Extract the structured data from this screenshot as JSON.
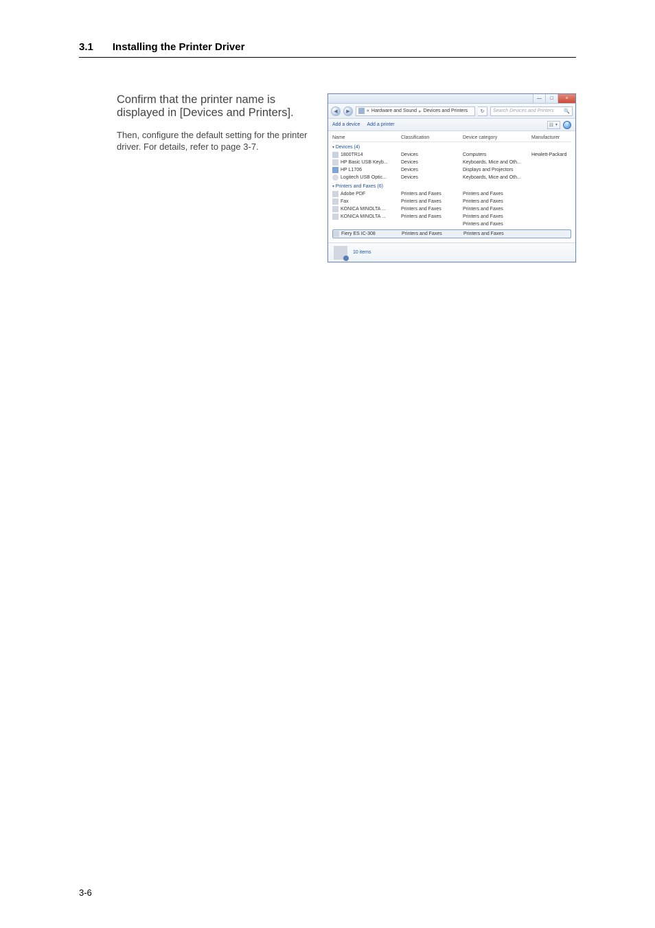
{
  "header": {
    "section_number": "3.1",
    "section_title": "Installing the Printer Driver"
  },
  "body": {
    "para1": "Confirm that the printer name is displayed in [Devices and Printers].",
    "para2": "Then, configure the default setting for the printer driver. For details, refer to page 3-7."
  },
  "win": {
    "breadcrumb": {
      "root_icon": "control-panel-icon",
      "seg1": "«",
      "seg2": "Hardware and Sound",
      "seg3": "Devices and Printers"
    },
    "refresh_tip": "Refresh",
    "search_placeholder": "Search Devices and Printers",
    "cmd": {
      "add_device": "Add a device",
      "add_printer": "Add a printer"
    },
    "columns": {
      "name": "Name",
      "classification": "Classification",
      "category": "Device category",
      "manufacturer": "Manufacturer"
    },
    "groups": {
      "devices": "Devices (4)",
      "printers": "Printers and Faxes (6)"
    },
    "devices": [
      {
        "name": "1800TR14",
        "classification": "Devices",
        "category": "Computers",
        "manufacturer": "Hewlett-Packard",
        "icon": "ic-pc"
      },
      {
        "name": "HP Basic USB Keyb...",
        "classification": "Devices",
        "category": "Keyboards, Mice and Oth...",
        "manufacturer": "",
        "icon": "ic-kb"
      },
      {
        "name": "HP L1706",
        "classification": "Devices",
        "category": "Displays and Projectors",
        "manufacturer": "",
        "icon": "ic-disp"
      },
      {
        "name": "Logitech USB Optic...",
        "classification": "Devices",
        "category": "Keyboards, Mice and Oth...",
        "manufacturer": "",
        "icon": "ic-mouse"
      }
    ],
    "printers": [
      {
        "name": "Adobe PDF",
        "classification": "Printers and Faxes",
        "category": "Printers and Faxes",
        "manufacturer": "",
        "icon": "ic-prn"
      },
      {
        "name": "Fax",
        "classification": "Printers and Faxes",
        "category": "Printers and Faxes",
        "manufacturer": "",
        "icon": "ic-prn"
      },
      {
        "name": "KONICA MINOLTA ...",
        "classification": "Printers and Faxes",
        "category": "Printers and Faxes",
        "manufacturer": "",
        "icon": "ic-prn"
      },
      {
        "name": "KONICA MINOLTA ...",
        "classification": "Printers and Faxes",
        "category": "Printers and Faxes",
        "manufacturer": "",
        "icon": "ic-prn"
      },
      {
        "name": "",
        "classification": "",
        "category": "Printers and Faxes",
        "manufacturer": "",
        "icon": ""
      }
    ],
    "selected": {
      "name": "Fiery ES IC-308",
      "classification": "Printers and Faxes",
      "category": "Printers and Faxes",
      "manufacturer": "",
      "icon": "ic-prn"
    },
    "status": "10 items",
    "titlebar": {
      "minimize": "—",
      "maximize": "□",
      "close": "×"
    }
  },
  "footer": {
    "page": "3-6"
  }
}
